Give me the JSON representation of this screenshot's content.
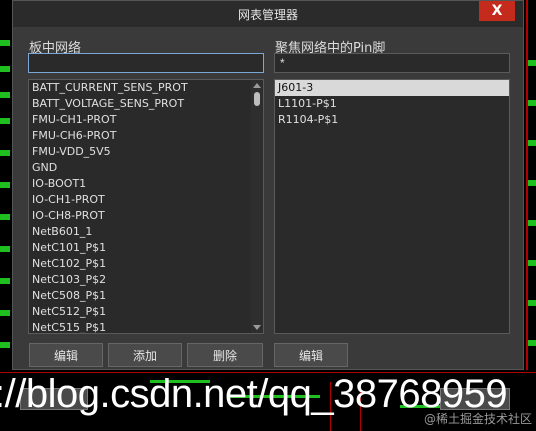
{
  "window": {
    "title": "网表管理器",
    "close_label": "X"
  },
  "left": {
    "label": "板中网络",
    "filter_value": "",
    "items": [
      "BATT_CURRENT_SENS_PROT",
      "BATT_VOLTAGE_SENS_PROT",
      "FMU-CH1-PROT",
      "FMU-CH6-PROT",
      "FMU-VDD_5V5",
      "GND",
      "IO-BOOT1",
      "IO-CH1-PROT",
      "IO-CH8-PROT",
      "NetB601_1",
      "NetC101_P$1",
      "NetC102_P$1",
      "NetC103_P$2",
      "NetC508_P$1",
      "NetC512_P$1",
      "NetC515_P$1"
    ],
    "buttons": {
      "edit": "编辑",
      "add": "添加",
      "delete": "删除"
    }
  },
  "right": {
    "label": "聚焦网络中的Pin脚",
    "filter_value": "*",
    "items": [
      "J601-3",
      "L1101-P$1",
      "R1104-P$1"
    ],
    "selected_index": 0,
    "buttons": {
      "edit": "编辑"
    }
  },
  "watermark": {
    "text": "://blog.csdn.net/qq_38768959",
    "secondary": "@稀土掘金技术社区"
  }
}
